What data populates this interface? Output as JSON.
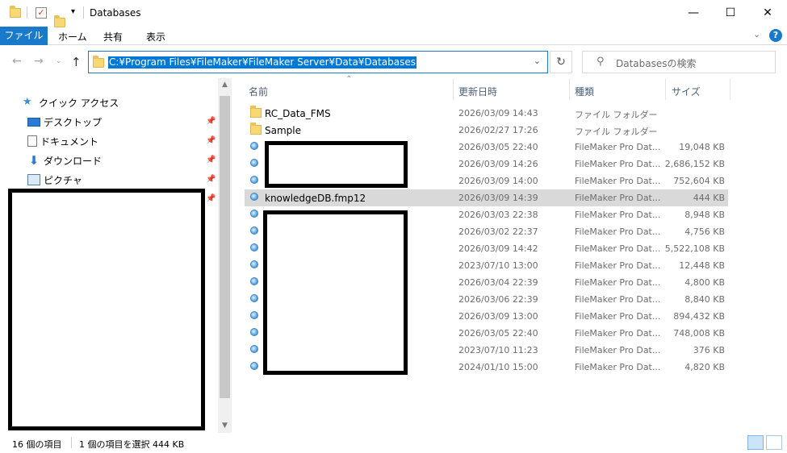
{
  "window": {
    "title": "Databases",
    "minimize": "—",
    "maximize": "☐",
    "close": "✕"
  },
  "ribbon": {
    "tabs": [
      "ファイル",
      "ホーム",
      "共有",
      "表示"
    ],
    "expand_icon": "chevron-down-icon",
    "help": "?"
  },
  "address_bar": {
    "path": "C:¥Program Files¥FileMaker¥FileMaker Server¥Data¥Databases",
    "search_placeholder": "Databasesの検索"
  },
  "nav_pane": {
    "items": [
      {
        "label": "クイック アクセス",
        "icon": "star-icon"
      },
      {
        "label": "デスクトップ",
        "icon": "desktop-icon"
      },
      {
        "label": "ドキュメント",
        "icon": "document-icon"
      },
      {
        "label": "ダウンロード",
        "icon": "download-icon"
      },
      {
        "label": "ピクチャ",
        "icon": "pictures-icon"
      }
    ]
  },
  "file_list": {
    "columns": [
      "名前",
      "更新日時",
      "種類",
      "サイズ"
    ],
    "rows": [
      {
        "name": "RC_Data_FMS",
        "date": "2026/03/09 14:43",
        "type": "ファイル フォルダー",
        "size": "",
        "icon": "folder-icon"
      },
      {
        "name": "Sample",
        "date": "2026/02/27 17:26",
        "type": "ファイル フォルダー",
        "size": "",
        "icon": "folder-icon"
      },
      {
        "name": "",
        "date": "2026/03/05 22:40",
        "type": "FileMaker Pro Dat...",
        "size": "19,048 KB",
        "icon": "filemaker-icon"
      },
      {
        "name": "",
        "date": "2026/03/09 14:26",
        "type": "FileMaker Pro Dat...",
        "size": "2,686,152 KB",
        "icon": "filemaker-icon"
      },
      {
        "name": "",
        "date": "2026/03/09 14:00",
        "type": "FileMaker Pro Dat...",
        "size": "752,604 KB",
        "icon": "filemaker-icon"
      },
      {
        "name": "knowledgeDB.fmp12",
        "date": "2026/03/09 14:39",
        "type": "FileMaker Pro Dat...",
        "size": "444 KB",
        "icon": "filemaker-icon",
        "selected": true
      },
      {
        "name": "",
        "date": "2026/03/03 22:38",
        "type": "FileMaker Pro Dat...",
        "size": "8,948 KB",
        "icon": "filemaker-icon"
      },
      {
        "name": "",
        "date": "2026/03/02 22:37",
        "type": "FileMaker Pro Dat...",
        "size": "4,756 KB",
        "icon": "filemaker-icon"
      },
      {
        "name": "",
        "date": "2026/03/09 14:42",
        "type": "FileMaker Pro Dat...",
        "size": "5,522,108 KB",
        "icon": "filemaker-icon"
      },
      {
        "name": "",
        "date": "2023/07/10 13:00",
        "type": "FileMaker Pro Dat...",
        "size": "12,448 KB",
        "icon": "filemaker-icon"
      },
      {
        "name": "",
        "date": "2026/03/04 22:39",
        "type": "FileMaker Pro Dat...",
        "size": "4,800 KB",
        "icon": "filemaker-icon"
      },
      {
        "name": "",
        "date": "2026/03/06 22:39",
        "type": "FileMaker Pro Dat...",
        "size": "8,840 KB",
        "icon": "filemaker-icon"
      },
      {
        "name": "",
        "date": "2026/03/09 13:00",
        "type": "FileMaker Pro Dat...",
        "size": "894,432 KB",
        "icon": "filemaker-icon"
      },
      {
        "name": "",
        "date": "2026/03/05 22:40",
        "type": "FileMaker Pro Dat...",
        "size": "748,008 KB",
        "icon": "filemaker-icon"
      },
      {
        "name": "",
        "date": "2023/07/10 11:23",
        "type": "FileMaker Pro Dat...",
        "size": "376 KB",
        "icon": "filemaker-icon"
      },
      {
        "name": "",
        "date": "2024/01/10 15:00",
        "type": "FileMaker Pro Dat...",
        "size": "4,820 KB",
        "icon": "filemaker-icon"
      }
    ]
  },
  "status_bar": {
    "item_count": "16 個の項目",
    "selection": "1 個の項目を選択  444 KB"
  },
  "colors": {
    "accent": "#1979ca",
    "selection": "#0078d7",
    "row_selected": "#d9d9d9"
  }
}
